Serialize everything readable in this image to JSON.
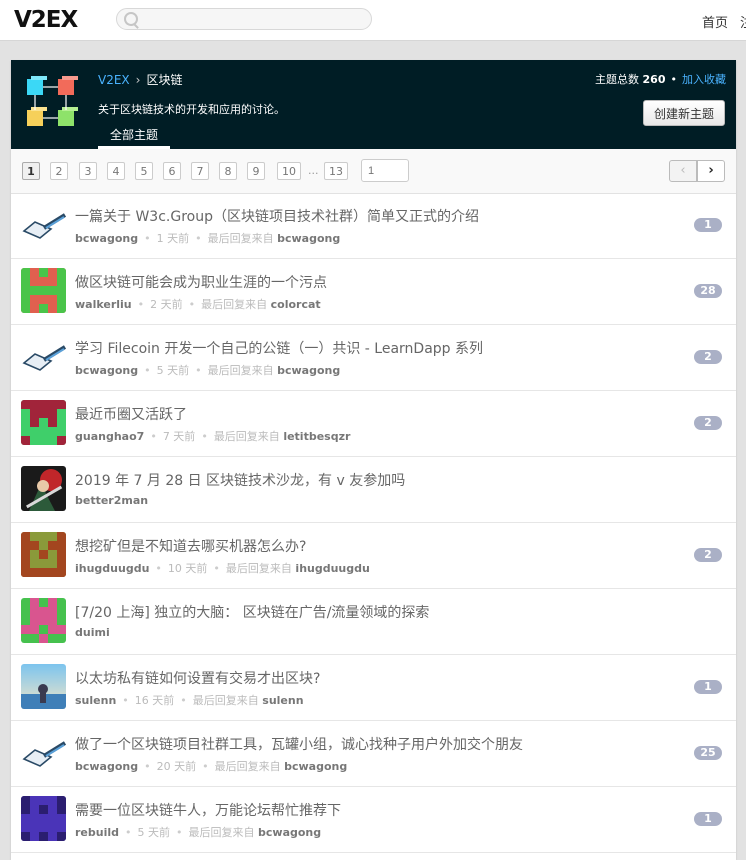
{
  "site": {
    "logo": "V2EX",
    "search_placeholder": "",
    "nav_home": "首页",
    "nav_more": "注"
  },
  "node": {
    "crumb_root": "V2EX",
    "crumb_sep": "›",
    "crumb_node": "区块链",
    "description": "关于区块链技术的开发和应用的讨论。",
    "stats_label": "主题总数",
    "stats_count": "260",
    "favorite": "加入收藏",
    "new_topic": "创建新主题",
    "tab_all": "全部主题"
  },
  "pager": {
    "pages": [
      "1",
      "2",
      "3",
      "4",
      "5",
      "6",
      "7",
      "8",
      "9",
      "10"
    ],
    "ellipsis": "...",
    "last": "13",
    "input_placeholder": "1",
    "prev": "‹",
    "next": "›"
  },
  "topics": [
    {
      "title": "一篇关于 W3c.Group（区块链项目技术社群）简单又正式的介绍",
      "author": "bcwagong",
      "time": "1 天前",
      "last_label": "最后回复来自",
      "last_user": "bcwagong",
      "replies": "1",
      "avatar": "pen"
    },
    {
      "title": "做区块链可能会成为职业生涯的一个污点",
      "author": "walkerliu",
      "time": "2 天前",
      "last_label": "最后回复来自",
      "last_user": "colorcat",
      "replies": "28",
      "avatar": "green-red"
    },
    {
      "title": "学习 Filecoin 开发一个自己的公链（一）共识 - LearnDapp 系列",
      "author": "bcwagong",
      "time": "5 天前",
      "last_label": "最后回复来自",
      "last_user": "bcwagong",
      "replies": "2",
      "avatar": "pen"
    },
    {
      "title": "最近币圈又活跃了",
      "author": "guanghao7",
      "time": "7 天前",
      "last_label": "最后回复来自",
      "last_user": "letitbesqzr",
      "replies": "2",
      "avatar": "red-green"
    },
    {
      "title": "2019 年 7 月 28 日 区块链技术沙龙，有 v 友参加吗",
      "author": "better2man",
      "time": "",
      "last_label": "",
      "last_user": "",
      "replies": "",
      "avatar": "anime"
    },
    {
      "title": "想挖矿但是不知道去哪买机器怎么办?",
      "author": "ihugduugdu",
      "time": "10 天前",
      "last_label": "最后回复来自",
      "last_user": "ihugduugdu",
      "replies": "2",
      "avatar": "brown-green"
    },
    {
      "title": "[7/20 上海] 独立的大脑： 区块链在广告/流量领域的探索",
      "author": "duimi",
      "time": "",
      "last_label": "",
      "last_user": "",
      "replies": "",
      "avatar": "green-pink"
    },
    {
      "title": "以太坊私有链如何设置有交易才出区块?",
      "author": "sulenn",
      "time": "16 天前",
      "last_label": "最后回复来自",
      "last_user": "sulenn",
      "replies": "1",
      "avatar": "sky"
    },
    {
      "title": "做了一个区块链项目社群工具，瓦罐小组，诚心找种子用户外加交个朋友",
      "author": "bcwagong",
      "time": "20 天前",
      "last_label": "最后回复来自",
      "last_user": "bcwagong",
      "replies": "25",
      "avatar": "pen"
    },
    {
      "title": "需要一位区块链牛人，万能论坛帮忙推荐下",
      "author": "rebuild",
      "time": "5 天前",
      "last_label": "最后回复来自",
      "last_user": "bcwagong",
      "replies": "1",
      "avatar": "purple"
    }
  ]
}
